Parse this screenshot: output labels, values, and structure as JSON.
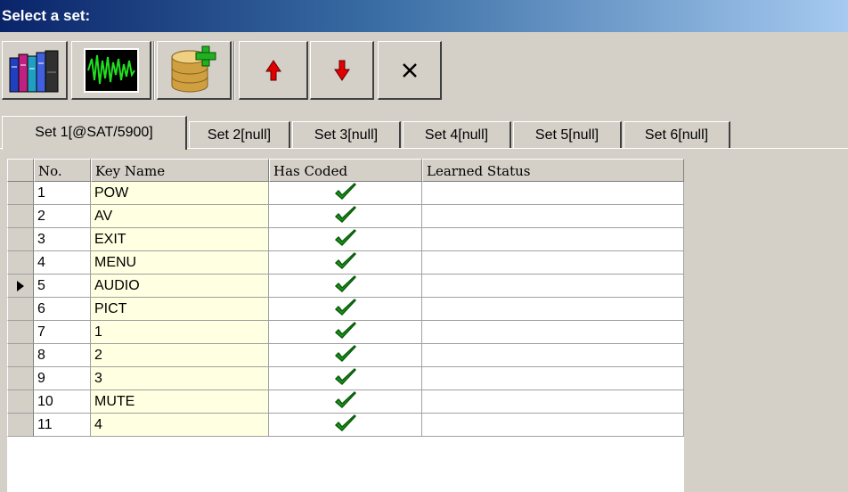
{
  "window": {
    "title": "Select a set:"
  },
  "toolbar": {
    "buttons": [
      {
        "name": "library-books-icon"
      },
      {
        "name": "waveform-icon"
      },
      {
        "name": "add-database-icon"
      },
      {
        "name": "move-up-icon"
      },
      {
        "name": "move-down-icon"
      },
      {
        "name": "delete-icon"
      }
    ]
  },
  "tabs": [
    {
      "label": "Set 1[@SAT/5900]",
      "active": true
    },
    {
      "label": "Set 2[null]"
    },
    {
      "label": "Set 3[null]"
    },
    {
      "label": "Set 4[null]"
    },
    {
      "label": "Set 5[null]"
    },
    {
      "label": "Set 6[null]"
    }
  ],
  "grid": {
    "columns": [
      "No.",
      "Key Name",
      "Has Coded",
      "Learned Status"
    ],
    "rows": [
      {
        "no": "1",
        "key": "POW",
        "coded": true,
        "status": ""
      },
      {
        "no": "2",
        "key": "AV",
        "coded": true,
        "status": ""
      },
      {
        "no": "3",
        "key": "EXIT",
        "coded": true,
        "status": ""
      },
      {
        "no": "4",
        "key": "MENU",
        "coded": true,
        "status": ""
      },
      {
        "no": "5",
        "key": "AUDIO",
        "coded": true,
        "status": "",
        "current": true
      },
      {
        "no": "6",
        "key": "PICT",
        "coded": true,
        "status": ""
      },
      {
        "no": "7",
        "key": "1",
        "coded": true,
        "status": ""
      },
      {
        "no": "8",
        "key": "2",
        "coded": true,
        "status": ""
      },
      {
        "no": "9",
        "key": "3",
        "coded": true,
        "status": ""
      },
      {
        "no": "10",
        "key": "MUTE",
        "coded": true,
        "status": ""
      },
      {
        "no": "11",
        "key": "4",
        "coded": true,
        "status": ""
      }
    ]
  },
  "colors": {
    "check": "#1a9a1a",
    "key_cell_bg": "#ffffe1",
    "titlebar": "#0a246a"
  }
}
